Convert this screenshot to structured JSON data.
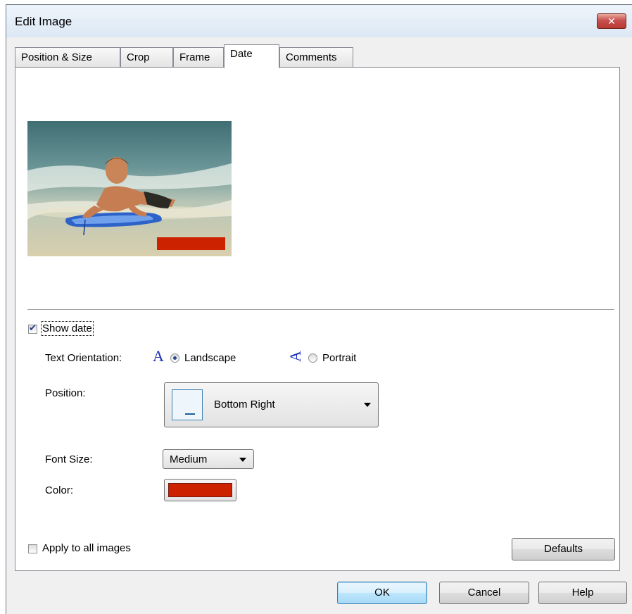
{
  "window": {
    "title": "Edit Image",
    "close_label": "✕"
  },
  "tabs": [
    {
      "label": "Position & Size"
    },
    {
      "label": "Crop"
    },
    {
      "label": "Frame"
    },
    {
      "label": "Date"
    },
    {
      "label": "Comments"
    }
  ],
  "active_tab": "Date",
  "show_date": {
    "label": "Show date",
    "checked": true
  },
  "text_orientation": {
    "label": "Text Orientation:",
    "landscape_label": "Landscape",
    "portrait_label": "Portrait",
    "selected": "Landscape"
  },
  "position": {
    "label": "Position:",
    "value": "Bottom Right"
  },
  "font_size": {
    "label": "Font Size:",
    "value": "Medium"
  },
  "color": {
    "label": "Color:",
    "value": "#cc2200"
  },
  "apply_all": {
    "label": "Apply to all images",
    "checked": false
  },
  "buttons": {
    "defaults": "Defaults",
    "ok": "OK",
    "cancel": "Cancel",
    "help": "Help"
  }
}
